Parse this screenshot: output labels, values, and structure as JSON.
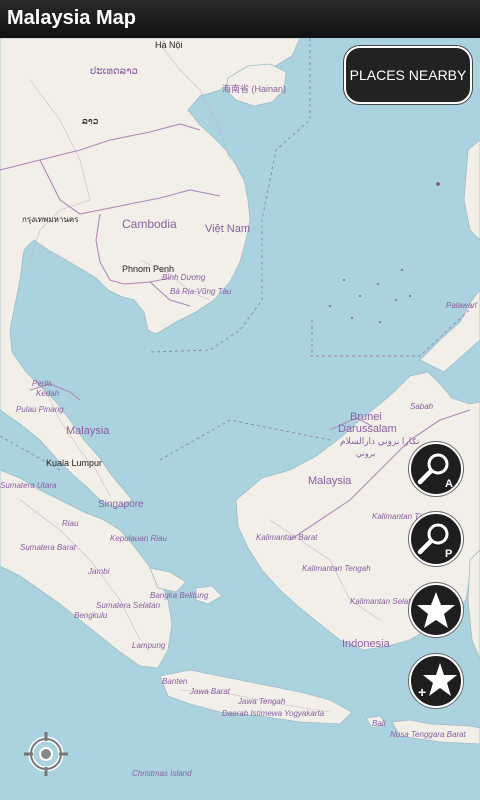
{
  "app": {
    "title": "Malaysia Map"
  },
  "buttons": {
    "places_nearby": "PLACES NEARBY"
  },
  "icons": {
    "search_address": "search-a-icon",
    "search_poi": "search-p-icon",
    "favorites": "star-icon",
    "add_favorite": "star-plus-icon",
    "locate": "crosshair-icon"
  },
  "search_address_badge": "A",
  "search_poi_badge": "P",
  "add_favorite_badge": "+",
  "colors": {
    "sea": "#aad3df",
    "land": "#f2efe9",
    "border": "#b08ab8",
    "label": "#8a5fa0"
  },
  "map": {
    "place_labels": {
      "hanoi": "Hà Nội",
      "laos_script": "ປະເທດລາວ",
      "laos2_script": "ລາວ",
      "hainan": "海南省 (Hainan)",
      "thai_script": "กรุงเทพมหานคร",
      "cambodia": "Cambodia",
      "vietnam": "Việt Nam",
      "phnom_penh": "Phnom Penh",
      "binh_duong": "Bình Dương",
      "ba_ria": "Bà Rịa-Vũng Tàu",
      "palawan": "Palawan",
      "perlis": "Perlis",
      "kedah": "Kedah",
      "pulau_pinang": "Pulau Pinang",
      "malaysia_west": "Malaysia",
      "kuala_lumpur": "Kuala Lumpur",
      "sumatera_utara": "Sumatera Utara",
      "singapore": "Singapore",
      "riau": "Riau",
      "kepulauan_riau": "Kepulauan Riau",
      "sumatera_barat": "Sumatera Barat",
      "jambi": "Jambi",
      "bangka": "Bangka Belitung",
      "sumatera_selatan": "Sumatera Selatan",
      "bengkulu": "Bengkulu",
      "lampung": "Lampung",
      "banten": "Banten",
      "jawa_barat": "Jawa Barat",
      "jawa_tengah": "Jawa Tengah",
      "yogyakarta": "Daerah Istimewa Yogyakarta",
      "bali": "Bali",
      "nusa_tenggara": "Nusa Tenggara Barat",
      "christmas": "Christmas Island",
      "brunei": "Brunei",
      "darussalam": "Darussalam",
      "brunei_arabic": "نݢارا بروني دارالسلام",
      "brunei_arabic2": "بروني",
      "sabah": "Sabah",
      "malaysia_east": "Malaysia",
      "kalimantan_barat": "Kalimantan Barat",
      "kalimantan_timur": "Kalimantan Timur",
      "kalimantan_tengah": "Kalimantan Tengah",
      "kalimantan_selatan": "Kalimantan Selatan",
      "indonesia": "Indonesia"
    }
  }
}
